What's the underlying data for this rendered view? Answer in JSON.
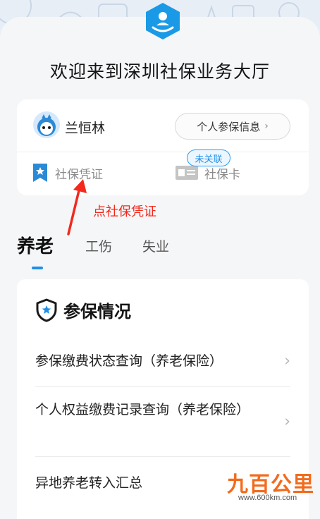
{
  "header": {
    "welcome_title": "欢迎来到深圳社保业务大厅"
  },
  "user_card": {
    "name": "兰恒林",
    "info_button_label": "个人参保信息",
    "info_button_chevron": "›",
    "social_security_cert_label": "社保凭证",
    "social_security_card_label": "社保卡",
    "card_status_badge": "未关联"
  },
  "annotation": {
    "text": "点社保凭证",
    "color": "#f2291c"
  },
  "tabs": [
    {
      "label": "养老",
      "active": true
    },
    {
      "label": "工伤",
      "active": false
    },
    {
      "label": "失业",
      "active": false
    }
  ],
  "panel": {
    "title": "参保情况",
    "rows": [
      {
        "label": "参保缴费状态查询（养老保险）",
        "chevron": "›"
      },
      {
        "label": "个人权益缴费记录查询（养老保险）",
        "chevron": "›"
      },
      {
        "label": "异地养老转入汇总",
        "chevron": ""
      }
    ]
  },
  "watermark": {
    "brand": "九百公里",
    "url": "www.600km.com"
  },
  "colors": {
    "accent": "#1f8fe8",
    "logo": "#1a9ae6",
    "annotation": "#f2291c"
  },
  "icons": {
    "logo": "person-in-hand-icon",
    "cert": "certificate-icon",
    "card": "id-card-icon",
    "shield": "shield-star-icon"
  }
}
